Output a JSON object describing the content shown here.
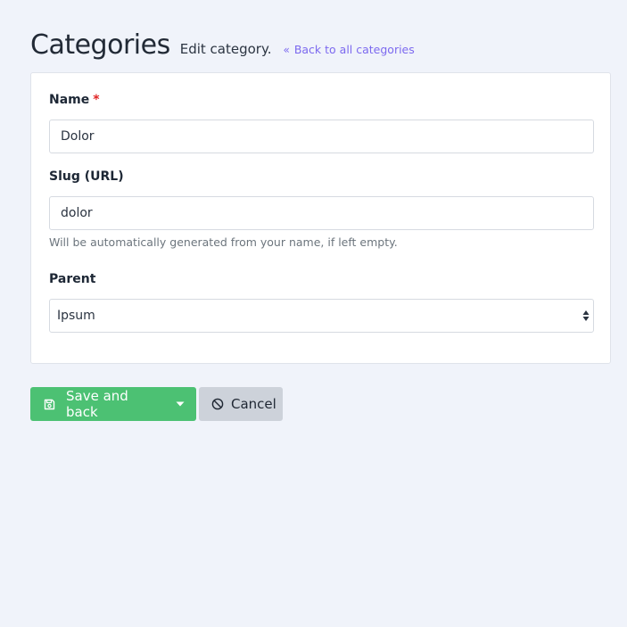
{
  "header": {
    "title": "Categories",
    "subtitle": "Edit category.",
    "back_link": "Back to all categories",
    "back_icon": "double-chevron-left-icon"
  },
  "form": {
    "name": {
      "label": "Name",
      "required_mark": "*",
      "value": "Dolor"
    },
    "slug": {
      "label": "Slug (URL)",
      "value": "dolor",
      "help": "Will be automatically generated from your name, if left empty."
    },
    "parent": {
      "label": "Parent",
      "selected": "Ipsum"
    }
  },
  "actions": {
    "save_label": "Save and back",
    "save_icon": "save-icon",
    "dropdown_icon": "caret-down-icon",
    "cancel_label": "Cancel",
    "cancel_icon": "ban-icon"
  },
  "colors": {
    "accent_link": "#7c69ef",
    "save_button": "#4cc173",
    "cancel_button": "#cdd2da",
    "required": "#e02424",
    "background": "#f0f3fa"
  }
}
